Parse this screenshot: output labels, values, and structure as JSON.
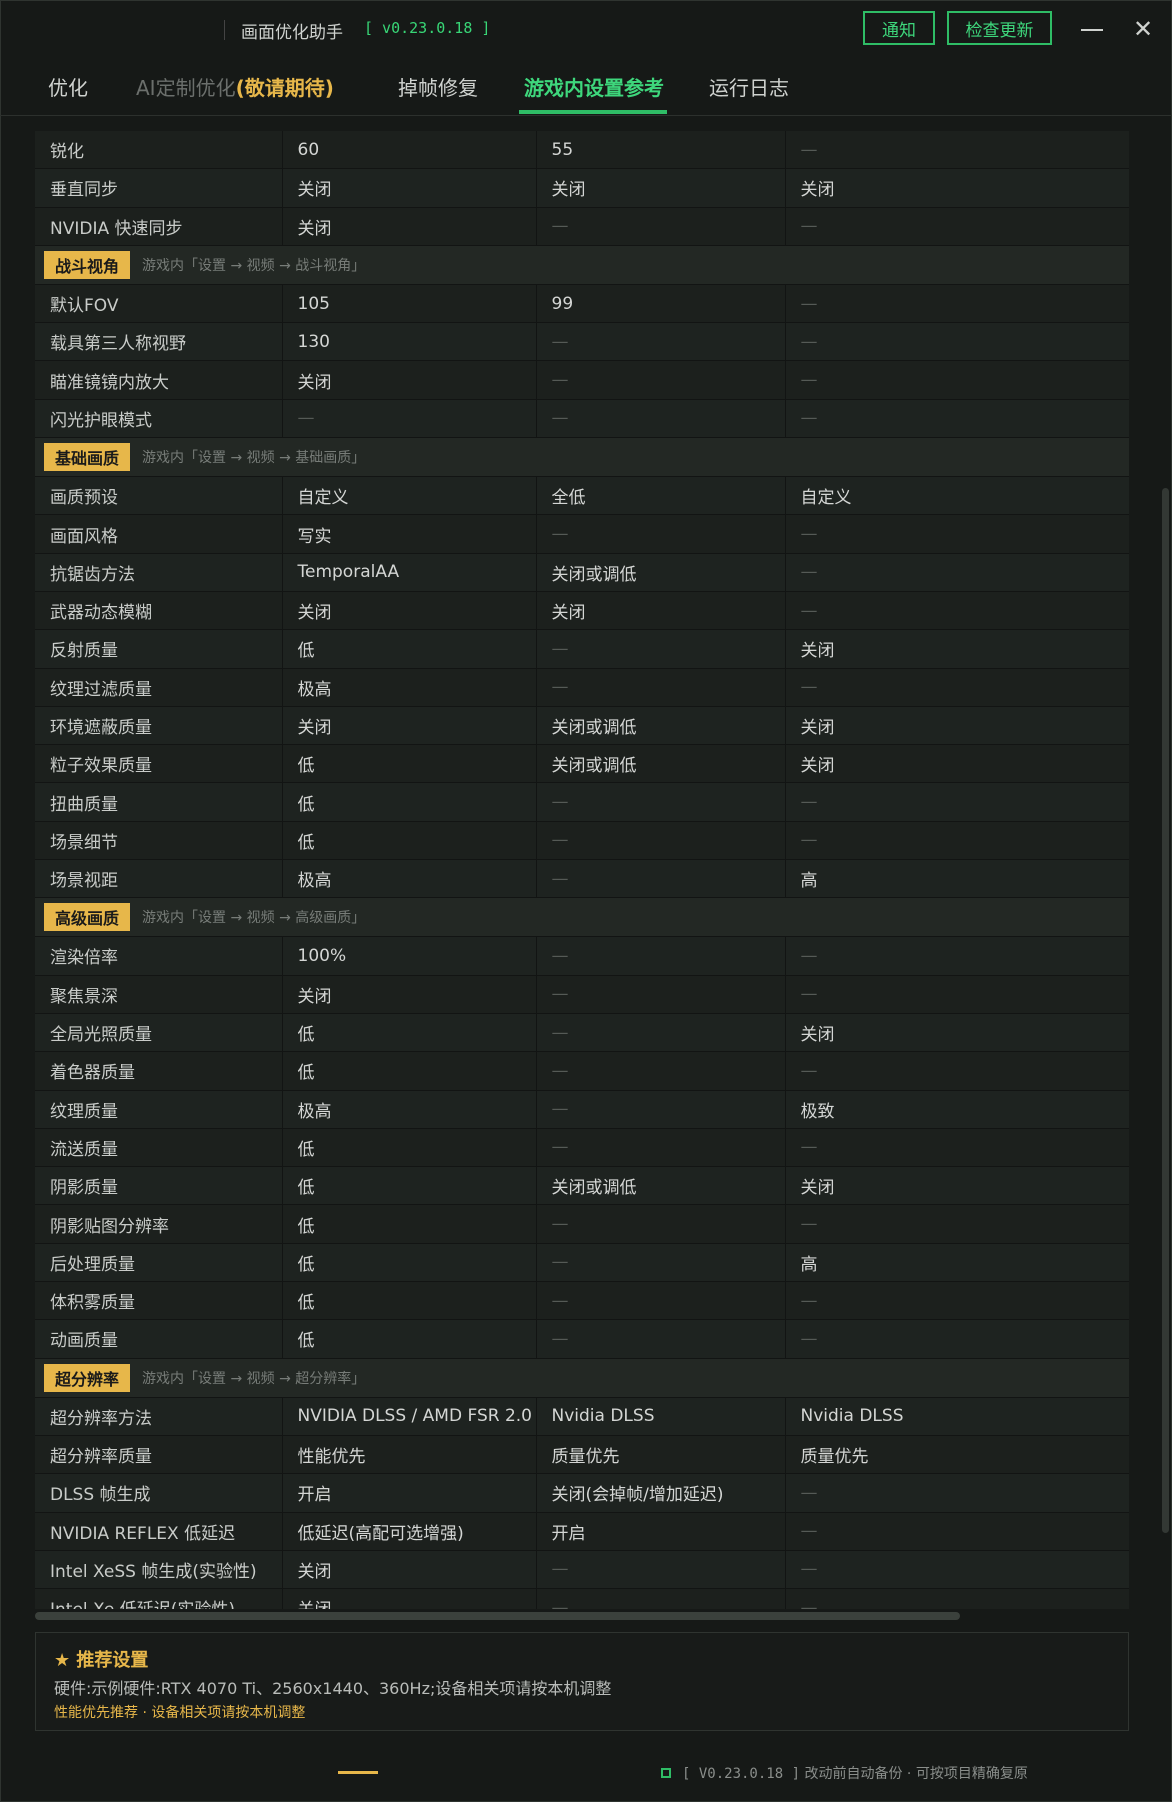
{
  "window": {
    "title": "画面优化助手",
    "version": "[ v0.23.0.18 ]",
    "notify_label": "通知",
    "update_label": "检查更新",
    "close_glyph": "✕"
  },
  "tabs": [
    {
      "label": "优化"
    },
    {
      "label": "AI定制优化",
      "suffix": "(敬请期待)"
    },
    {
      "label": "掉帧修复"
    },
    {
      "label": "游戏内设置参考"
    },
    {
      "label": "运行日志"
    }
  ],
  "table": {
    "sections": [
      {
        "badge": "",
        "crumb": "",
        "rows": [
          {
            "k": "锐化",
            "a": "60",
            "b": "55",
            "c": "—"
          },
          {
            "k": "垂直同步",
            "a": "关闭",
            "b": "关闭",
            "c": "关闭"
          },
          {
            "k": "NVIDIA 快速同步",
            "a": "关闭",
            "b": "—",
            "c": "—"
          }
        ]
      },
      {
        "badge": "战斗视角",
        "crumb": "游戏内「设置 → 视频 → 战斗视角」",
        "rows": [
          {
            "k": "默认FOV",
            "a": "105",
            "b": "99",
            "c": "—"
          },
          {
            "k": "载具第三人称视野",
            "a": "130",
            "b": "—",
            "c": "—"
          },
          {
            "k": "瞄准镜镜内放大",
            "a": "关闭",
            "b": "—",
            "c": "—"
          },
          {
            "k": "闪光护眼模式",
            "a": "—",
            "b": "—",
            "c": "—"
          }
        ]
      },
      {
        "badge": "基础画质",
        "crumb": "游戏内「设置 → 视频 → 基础画质」",
        "rows": [
          {
            "k": "画质预设",
            "a": "自定义",
            "b": "全低",
            "c": "自定义"
          },
          {
            "k": "画面风格",
            "a": "写实",
            "b": "—",
            "c": "—"
          },
          {
            "k": "抗锯齿方法",
            "a": "TemporalAA",
            "b": "关闭或调低",
            "c": "—"
          },
          {
            "k": "武器动态模糊",
            "a": "关闭",
            "b": "关闭",
            "c": "—"
          },
          {
            "k": "反射质量",
            "a": "低",
            "b": "—",
            "c": "关闭"
          },
          {
            "k": "纹理过滤质量",
            "a": "极高",
            "b": "—",
            "c": "—"
          },
          {
            "k": "环境遮蔽质量",
            "a": "关闭",
            "b": "关闭或调低",
            "c": "关闭"
          },
          {
            "k": "粒子效果质量",
            "a": "低",
            "b": "关闭或调低",
            "c": "关闭"
          },
          {
            "k": "扭曲质量",
            "a": "低",
            "b": "—",
            "c": "—"
          },
          {
            "k": "场景细节",
            "a": "低",
            "b": "—",
            "c": "—"
          },
          {
            "k": "场景视距",
            "a": "极高",
            "b": "—",
            "c": "高"
          }
        ]
      },
      {
        "badge": "高级画质",
        "crumb": "游戏内「设置 → 视频 → 高级画质」",
        "rows": [
          {
            "k": "渲染倍率",
            "a": "100%",
            "b": "—",
            "c": "—"
          },
          {
            "k": "聚焦景深",
            "a": "关闭",
            "b": "—",
            "c": "—"
          },
          {
            "k": "全局光照质量",
            "a": "低",
            "b": "—",
            "c": "关闭"
          },
          {
            "k": "着色器质量",
            "a": "低",
            "b": "—",
            "c": "—"
          },
          {
            "k": "纹理质量",
            "a": "极高",
            "b": "—",
            "c": "极致"
          },
          {
            "k": "流送质量",
            "a": "低",
            "b": "—",
            "c": "—"
          },
          {
            "k": "阴影质量",
            "a": "低",
            "b": "关闭或调低",
            "c": "关闭"
          },
          {
            "k": "阴影贴图分辨率",
            "a": "低",
            "b": "—",
            "c": "—"
          },
          {
            "k": "后处理质量",
            "a": "低",
            "b": "—",
            "c": "高"
          },
          {
            "k": "体积雾质量",
            "a": "低",
            "b": "—",
            "c": "—"
          },
          {
            "k": "动画质量",
            "a": "低",
            "b": "—",
            "c": "—"
          }
        ]
      },
      {
        "badge": "超分辨率",
        "crumb": "游戏内「设置 → 视频 → 超分辨率」",
        "rows": [
          {
            "k": "超分辨率方法",
            "a": "NVIDIA DLSS / AMD FSR 2.0",
            "b": "Nvidia DLSS",
            "c": "Nvidia DLSS"
          },
          {
            "k": "超分辨率质量",
            "a": "性能优先",
            "b": "质量优先",
            "c": "质量优先"
          },
          {
            "k": "DLSS 帧生成",
            "a": "开启",
            "b": "关闭(会掉帧/增加延迟)",
            "c": "—"
          },
          {
            "k": "NVIDIA REFLEX 低延迟",
            "a": "低延迟(高配可选增强)",
            "b": "开启",
            "c": "—"
          },
          {
            "k": "Intel XeSS 帧生成(实验性)",
            "a": "关闭",
            "b": "—",
            "c": "—"
          },
          {
            "k": "Intel Xe 低延迟(实验性)",
            "a": "关闭",
            "b": "—",
            "c": "—"
          }
        ]
      }
    ]
  },
  "recommend": {
    "title": "★ 推荐设置",
    "hardware": "硬件:示例硬件:RTX 4070 Ti、2560x1440、360Hz;设备相关项请按本机调整",
    "note": "性能优先推荐 · 设备相关项请按本机调整"
  },
  "footer": {
    "version": "[ V0.23.0.18 ]",
    "text": "改动前自动备份 · 可按项目精确复原"
  },
  "colors": {
    "accent_green": "#2fbd66",
    "accent_gold": "#e7b74a",
    "background": "#161917"
  }
}
